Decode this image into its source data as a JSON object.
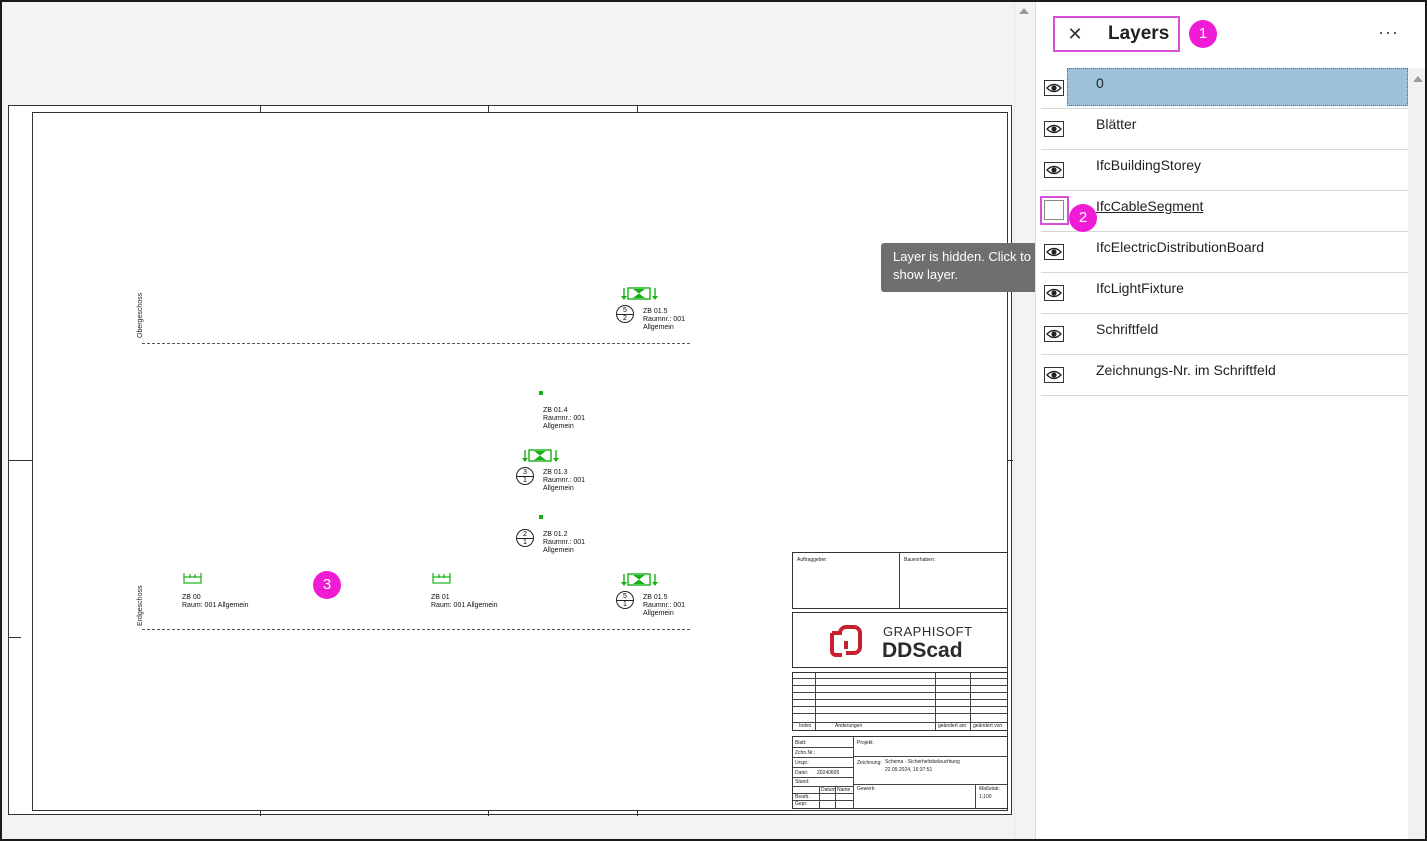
{
  "panel": {
    "title": "Layers",
    "close_icon": "close-icon",
    "more_icon": "more-options-icon",
    "close_glyph": "✕",
    "more_glyph": "···"
  },
  "badges": [
    "1",
    "2",
    "3"
  ],
  "layers": [
    {
      "name": "0",
      "visible": true,
      "selected": true
    },
    {
      "name": "Blätter",
      "visible": true
    },
    {
      "name": "IfcBuildingStorey",
      "visible": true
    },
    {
      "name": "IfcCableSegment",
      "visible": false
    },
    {
      "name": "IfcElectricDistributionBoard",
      "visible": true
    },
    {
      "name": "IfcLightFixture",
      "visible": true
    },
    {
      "name": "Schriftfeld",
      "visible": true
    },
    {
      "name": "Zeichnungs-Nr. im Schriftfeld",
      "visible": true
    }
  ],
  "tooltip": "Layer is hidden. Click to show layer.",
  "drawing": {
    "storey_upper": "Obergeschoss",
    "storey_ground": "Erdgeschoss",
    "symbols": [
      {
        "id": "zb015-og",
        "label": "ZB 01.5\nRaumnr.: 001\nAllgemein",
        "top": "5",
        "bottom": "2"
      },
      {
        "id": "zb014",
        "label": "ZB 01.4\nRaumnr.: 001\nAllgemein"
      },
      {
        "id": "zb013",
        "label": "ZB 01.3\nRaumnr.: 001\nAllgemein",
        "top": "3",
        "bottom": "1"
      },
      {
        "id": "zb012",
        "label": "ZB 01.2\nRaumnr.: 001\nAllgemein",
        "top": "2",
        "bottom": "1"
      },
      {
        "id": "zb00",
        "label": "ZB 00\nRaum: 001 Allgemein"
      },
      {
        "id": "zb01",
        "label": "ZB 01\nRaum: 001 Allgemein"
      },
      {
        "id": "zb015-eg",
        "label": "ZB 01.5\nRaumnr.: 001\nAllgemein",
        "top": "5",
        "bottom": "1"
      }
    ]
  },
  "titleblock": {
    "auftraggeber": "Auftraggeber:",
    "bauvorhaben": "Bauvorhaben:",
    "logo_top": "GRAPHISOFT",
    "logo_bottom": "DDScad",
    "index": "Index",
    "aenderungen": "Änderungen",
    "geaendert_am": "geändert am",
    "geaendert_von": "geändert von",
    "blatt": "Blatt:",
    "zchnr": "Zchn.Nr.:",
    "urspr": "Urspr.:",
    "datei": "Datei:",
    "datei_val": "20240605",
    "stand": "Stand:",
    "bearb": "Bearb.",
    "datum": "Datum",
    "name": "Name",
    "gepr": "Gepr.",
    "projekt": "Projekt:",
    "zeichnung": "Zeichnung:",
    "zeichnung_val1": "Schema - Sicherheitsbeleuchtung",
    "zeichnung_val2": "22.09.2024, 16:37:51",
    "gewerk": "Gewerk:",
    "massstab": "Maßstab:",
    "massstab_val": "1:100"
  },
  "colors": {
    "selected_row": "#9dc1d9",
    "badge": "#f01bd4",
    "highlight": "#d64fd6",
    "symbol_green": "#16b016",
    "logo_red": "#c8202f"
  }
}
